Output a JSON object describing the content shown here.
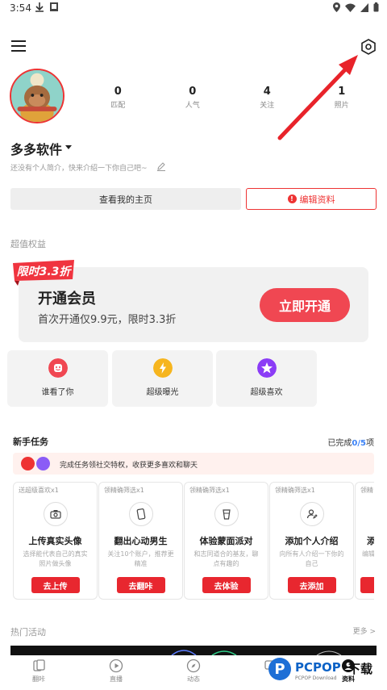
{
  "status_bar": {
    "time": "3:54"
  },
  "profile": {
    "name": "多多软件",
    "bio": "还没有个人简介，快来介绍一下你自己吧~",
    "stats": [
      {
        "num": "0",
        "label": "匹配"
      },
      {
        "num": "0",
        "label": "人气"
      },
      {
        "num": "4",
        "label": "关注"
      },
      {
        "num": "1",
        "label": "照片"
      }
    ],
    "view_home_label": "查看我的主页",
    "edit_label": "编辑资料"
  },
  "benefits": {
    "title": "超值权益",
    "badge_text": "限时3.3折",
    "vip_title": "开通会员",
    "vip_sub": "首次开通仅9.9元，限时3.3折",
    "open_label": "立即开通",
    "features": [
      {
        "label": "谁看了你",
        "color": "#f04752"
      },
      {
        "label": "超级曝光",
        "color": "#f6b51e"
      },
      {
        "label": "超级喜欢",
        "color": "#8b3cf6"
      }
    ]
  },
  "tasks": {
    "title": "新手任务",
    "progress_prefix": "已完成",
    "progress": "0/5",
    "progress_suffix": "项",
    "banner_text": "完成任务领社交特权，收获更多喜欢和聊天",
    "items": [
      {
        "tag": "送超级喜欢x1",
        "name": "上传真实头像",
        "desc": "选择能代表自己的真实照片做头像",
        "button": "去上传",
        "icon": "camera-icon"
      },
      {
        "tag": "领精确筛选x1",
        "name": "翻出心动男生",
        "desc": "关注10个账户，推荐更精准",
        "button": "去翻咔",
        "icon": "card-icon"
      },
      {
        "tag": "领精确筛选x1",
        "name": "体验蒙面派对",
        "desc": "和志同道合的基友，聊点有趣的",
        "button": "去体验",
        "icon": "cup-icon"
      },
      {
        "tag": "领精确筛选x1",
        "name": "添加个人介绍",
        "desc": "向所有人介绍一下你的自己",
        "button": "去添加",
        "icon": "user-edit-icon"
      },
      {
        "tag": "领精",
        "name": "添",
        "desc": "编辑",
        "button": "",
        "icon": ""
      }
    ]
  },
  "hot": {
    "title": "热门活动",
    "more": "更多 >"
  },
  "tabbar": {
    "items": [
      {
        "label": "翻咔",
        "icon": "cards-icon"
      },
      {
        "label": "直播",
        "icon": "play-icon"
      },
      {
        "label": "动态",
        "icon": "compass-icon"
      },
      {
        "label": "",
        "icon": "message-icon"
      },
      {
        "label": "资料",
        "icon": "profile-icon"
      }
    ]
  },
  "watermark": {
    "brand": "PCPOP",
    "suffix": "下载",
    "sub": "PCPOP Download"
  }
}
